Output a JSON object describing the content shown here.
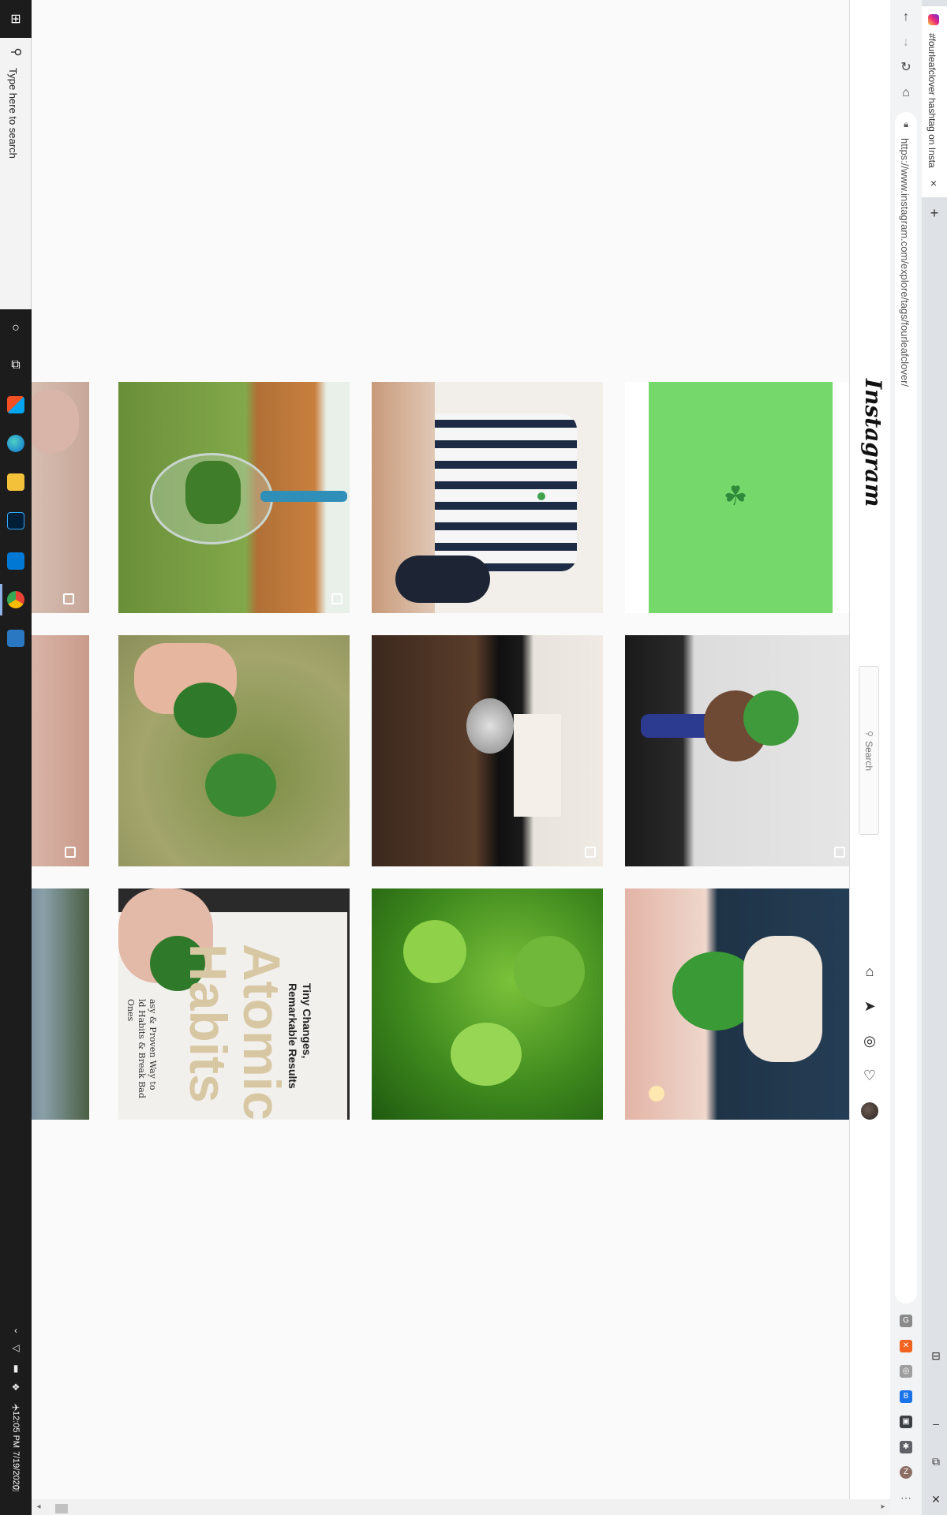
{
  "browser": {
    "tab_title": "#fourleafclover hashtag on Insta",
    "url": "https://www.instagram.com/explore/tags/fourleafclover/",
    "new_tab_label": "+",
    "close_tab_label": "×",
    "nav": [
      "back-icon",
      "forward-icon",
      "reload-icon",
      "home-icon"
    ],
    "extensions": [
      {
        "name": "grammarly-ext-icon",
        "color": "#8a8a8a",
        "glyph": "G"
      },
      {
        "name": "orange-ext-icon",
        "color": "#f26322",
        "glyph": "⚠"
      },
      {
        "name": "grey-ext-icon",
        "color": "#9e9e9e",
        "glyph": "◎"
      },
      {
        "name": "blue-ext-icon",
        "color": "#1a73e8",
        "glyph": "B"
      },
      {
        "name": "screen-ext-icon",
        "color": "#3c4043",
        "glyph": "▣"
      },
      {
        "name": "puzzle-icon",
        "color": "#5f6368",
        "glyph": "✱"
      },
      {
        "name": "profile-z-icon",
        "color": "#8d6e63",
        "glyph": "Z"
      },
      {
        "name": "menu-icon",
        "color": "#5f6368",
        "glyph": "⋯"
      }
    ],
    "window_buttons": [
      "minimize-icon",
      "restore-icon",
      "close-window-icon"
    ]
  },
  "taskbar": {
    "search_placeholder": "Type here to search",
    "time": "12:05 PM",
    "date": "7/19/2020",
    "apps": [
      "cortana-icon",
      "task-view-icon",
      "store-icon",
      "edge-icon",
      "file-explorer-icon",
      "photoshop-icon",
      "azure-icon",
      "chrome-icon",
      "settings-app-icon"
    ]
  },
  "instagram": {
    "logo": "Instagram",
    "search_placeholder": "Search",
    "nav_icons": [
      "home-icon",
      "direct-icon",
      "explore-icon",
      "activity-heart-icon",
      "profile-avatar"
    ]
  },
  "colors": {
    "page_bg": "#fafafa",
    "taskbar": "#1c1c1c",
    "clover_green_tile": "#74d86a"
  },
  "book": {
    "title_line1": "Tiny Changes,",
    "title_line2": "Remarkable Results",
    "big_word1": "Atomic",
    "big_word2": "Habits",
    "subtitle1": "asy & Proven Way to",
    "subtitle2": "ld Habits & Break Bad Ones"
  }
}
